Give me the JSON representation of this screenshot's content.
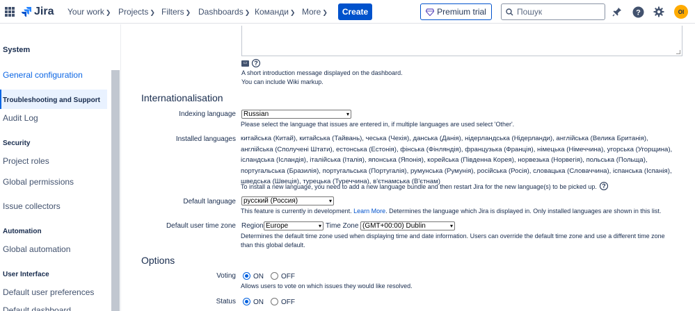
{
  "topnav": {
    "logo": "Jira",
    "items": [
      {
        "label": "Your work"
      },
      {
        "label": "Projects"
      },
      {
        "label": "Filters"
      },
      {
        "label": "Dashboards"
      },
      {
        "label": "Команди"
      },
      {
        "label": "More"
      }
    ],
    "create_label": "Create",
    "premium_label": "Premium trial",
    "search_placeholder": "Пошук",
    "avatar_initials": "OI"
  },
  "sidebar": {
    "heading": "System",
    "active_item": "General configuration",
    "sections": [
      {
        "title": "Troubleshooting and Support",
        "items": [
          "Audit Log"
        ]
      },
      {
        "title": "Security",
        "items": [
          "Project roles",
          "Global permissions",
          "Issue collectors"
        ]
      },
      {
        "title": "Automation",
        "items": [
          "Global automation"
        ]
      },
      {
        "title": "User Interface",
        "items": [
          "Default user preferences",
          "Default dashboard"
        ]
      }
    ]
  },
  "intro": {
    "help_line1": "A short introduction message displayed on the dashboard.",
    "help_line2": "You can include Wiki markup."
  },
  "i18n": {
    "title": "Internationalisation",
    "indexing_label": "Indexing language",
    "indexing_value": "Russian",
    "indexing_help": "Please select the language that issues are entered in, if multiple languages are used select 'Other'.",
    "installed_label": "Installed languages",
    "installed_list": "китайська (Китай), китайська (Тайвань), чеська (Чехія), данська (Данія), нідерландська (Нідерланди), англійська (Велика Британія), англійська (Сполучені Штати), естонська (Естонія), фінська (Фінляндія), французька (Франція), німецька (Німеччина), угорська (Угорщина), ісландська (Ісландія), італійська (Італія), японська (Японія), корейська (Південна Корея), норвезька (Норвегія), польська (Польща), португальська (Бразилія), португальська (Португалія), румунська (Румунія), російська (Росія), словацька (Словаччина), іспанська (Іспанія), шведська (Швеція), турецька (Туреччина), в'єтнамська (В'єтнам)",
    "installed_help": "To install a new language, you need to add a new language bundle and then restart Jira for the new language(s) to be picked up.",
    "default_lang_label": "Default language",
    "default_lang_value": "русский (Россия)",
    "default_lang_help_pre": "This feature is currently in development.",
    "default_lang_link": "Learn More",
    "default_lang_help_post": ". Determines the language which Jira is displayed in. Only installed languages are shown in this list.",
    "tz_label": "Default user time zone",
    "region_label": "Region",
    "region_value": "Europe",
    "tz_inner_label": "Time Zone",
    "tz_value": "(GMT+00:00) Dublin",
    "tz_help_line1": "Determines the default time zone used when displaying time and date information. Users can override the default time zone and use a different time zone",
    "tz_help_line2": "than this global default."
  },
  "options": {
    "title": "Options",
    "voting_label": "Voting",
    "voting_help": "Allows users to vote on which issues they would like resolved.",
    "status_label": "Status",
    "on_label": "ON",
    "off_label": "OFF"
  }
}
